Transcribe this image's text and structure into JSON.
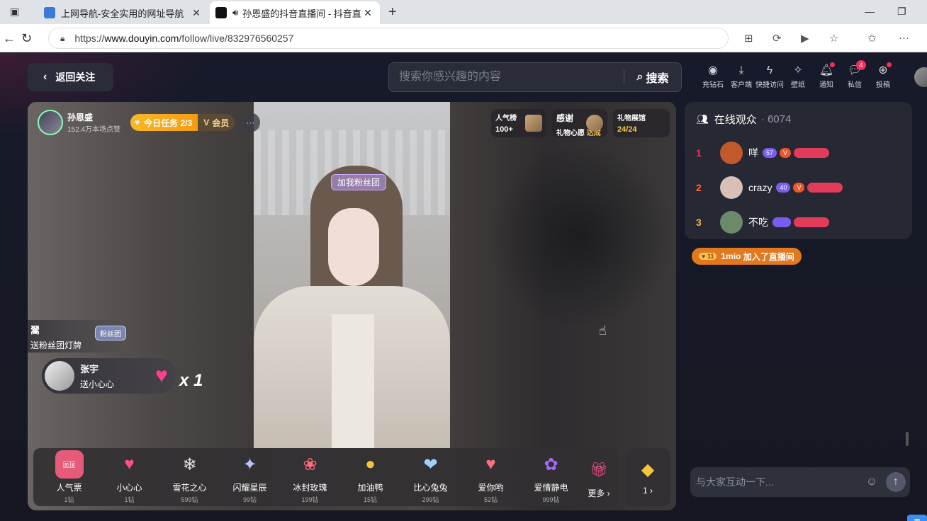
{
  "browser": {
    "tabs": [
      {
        "title": "上网导航-安全实用的网址导航",
        "fav_color": "#3a7bd5"
      },
      {
        "title": "孙恩盛的抖音直播间 - 抖音直",
        "fav_color": "#111111"
      }
    ],
    "url_prefix": "https://",
    "url_domain": "www.douyin.com",
    "url_path": "/follow/live/832976560257"
  },
  "header": {
    "back_label": "返回关注",
    "search_placeholder": "搜索你感兴趣的内容",
    "search_button": "搜索",
    "icons": [
      {
        "name": "recharge-icon",
        "glyph": "◉",
        "label": "充钻石"
      },
      {
        "name": "download-icon",
        "glyph": "⤓",
        "label": "客户端"
      },
      {
        "name": "lightning-icon",
        "glyph": "ϟ",
        "label": "快捷访问"
      },
      {
        "name": "wallpaper-icon",
        "glyph": "✧",
        "label": "壁纸"
      },
      {
        "name": "bell-icon",
        "glyph": "♫",
        "label": "通知",
        "dot": true
      },
      {
        "name": "message-icon",
        "glyph": "◌",
        "label": "私信",
        "badge": "4"
      },
      {
        "name": "upload-icon",
        "glyph": "⊕",
        "label": "投稿",
        "dot": true
      }
    ]
  },
  "live": {
    "host_name": "孙恩盛",
    "host_likes": "152.4万本场点赞",
    "task_label": "今日任务 2/3",
    "vip_label": "会员",
    "more": "···",
    "fan_tag": "加我粉丝团",
    "rank": {
      "l1": "人气榜",
      "l2": "100+"
    },
    "thanks": {
      "l1": "感谢",
      "l2a": "礼物心愿",
      "l2b": "达成"
    },
    "hall": {
      "l1": "礼物展馆",
      "l2": "24/24"
    },
    "fan_msg": {
      "user": "翯",
      "text": "送粉丝团灯牌",
      "chip": "粉丝团"
    },
    "gift_msg": {
      "user": "张宇",
      "text": "送小心心",
      "combo": "x 1"
    },
    "gifts": [
      {
        "name": "人气票",
        "price": "1钻",
        "glyph": "🎫",
        "bg": "#e65b7a"
      },
      {
        "name": "小心心",
        "price": "1钻",
        "glyph": "♥",
        "bg": "transparent",
        "color": "#ff4f8e"
      },
      {
        "name": "雪花之心",
        "price": "599钻",
        "glyph": "❄",
        "bg": "transparent",
        "color": "#ddd"
      },
      {
        "name": "闪耀星辰",
        "price": "99钻",
        "glyph": "✦",
        "bg": "transparent",
        "color": "#b9c3ff"
      },
      {
        "name": "冰封玫瑰",
        "price": "199钻",
        "glyph": "❀",
        "bg": "transparent",
        "color": "#ff6b7d"
      },
      {
        "name": "加油鸭",
        "price": "15钻",
        "glyph": "●",
        "bg": "transparent",
        "color": "#f7c23c"
      },
      {
        "name": "比心兔兔",
        "price": "299钻",
        "glyph": "❤",
        "bg": "transparent",
        "color": "#9bd3ff"
      },
      {
        "name": "爱你哟",
        "price": "52钻",
        "glyph": "♥",
        "bg": "transparent",
        "color": "#ff6d7d"
      },
      {
        "name": "爱情静电",
        "price": "999钻",
        "glyph": "✿",
        "bg": "transparent",
        "color": "#a46aff"
      }
    ],
    "more_label": "更多",
    "coin_value": "1"
  },
  "audience": {
    "title": "在线观众",
    "count": "6074",
    "rows": [
      {
        "rank": "1",
        "name": "咩",
        "level": "57",
        "color": "#c2592b"
      },
      {
        "rank": "2",
        "name": "crazy",
        "level": "40",
        "color": "#d9c0b6"
      },
      {
        "rank": "3",
        "name": "不吃",
        "level": "",
        "color": "#6a8a6a"
      }
    ],
    "join_user": "1mio",
    "join_level": "11",
    "join_text": "加入了直播间",
    "input_placeholder": "与大家互动一下..."
  },
  "colors": {
    "accent": "#fe2c55",
    "page_bg": "#161722"
  }
}
